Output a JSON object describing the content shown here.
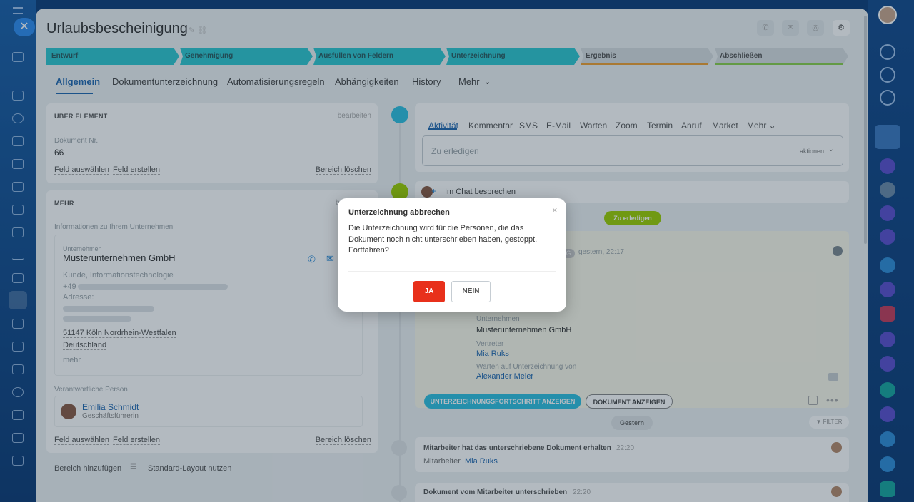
{
  "title": "Urlaubsbescheinigung",
  "stages": [
    {
      "label": "Entwurf",
      "color": "#2fc7d0",
      "text": "#2a5a5f"
    },
    {
      "label": "Genehmigung",
      "color": "#2fc7d0",
      "text": "#2a5a5f"
    },
    {
      "label": "Ausfüllen von Feldern",
      "color": "#2fc7d0",
      "text": "#2a5a5f"
    },
    {
      "label": "Unterzeichnung",
      "color": "#2fc7d0",
      "text": "#2a5a5f"
    },
    {
      "label": "Ergebnis",
      "color": "#d8dde0",
      "text": "#555"
    },
    {
      "label": "Abschließen",
      "color": "#d8dde0",
      "text": "#555"
    }
  ],
  "tabs": [
    "Allgemein",
    "Dokumentunterzeichnung",
    "Automatisierungsregeln",
    "Abhängigkeiten",
    "History",
    "Mehr"
  ],
  "about": {
    "header": "ÜBER ELEMENT",
    "edit": "bearbeiten",
    "doc_label": "Dokument Nr.",
    "doc_value": "66",
    "select_field": "Feld auswählen",
    "create_field": "Feld erstellen",
    "delete_section": "Bereich löschen"
  },
  "more": {
    "header": "MEHR",
    "edit_fragment": "b",
    "company_info": "Informationen zu Ihrem Unternehmen",
    "company_label": "Unternehmen",
    "company_name": "Musterunternehmen GmbH",
    "company_type": "Kunde, Informationstechnologie",
    "phone_prefix": "+49",
    "address_label": "Adresse:",
    "city": "51147 Köln Nordrhein-Westfalen",
    "country": "Deutschland",
    "mehr": "mehr",
    "resp_label": "Verantwortliche Person",
    "resp_name": "Emilia Schmidt",
    "resp_role": "Geschäftsführerin",
    "select_field": "Feld auswählen",
    "create_field": "Feld erstellen",
    "delete_section": "Bereich löschen"
  },
  "footer": {
    "add_section": "Bereich hinzufügen",
    "standard_layout": "Standard-Layout nutzen"
  },
  "activity": {
    "tabs": [
      "Aktivität",
      "Kommentar",
      "SMS",
      "E-Mail",
      "Warten",
      "Zoom",
      "Termin",
      "Anruf",
      "Market",
      "Mehr"
    ],
    "placeholder": "Zu erledigen",
    "actions": "aktionen"
  },
  "chat": "Im Chat besprechen",
  "todo_badge": "Zu erledigen",
  "doc_item": {
    "badge": "G",
    "time": "gestern, 22:17",
    "company_label": "Unternehmen",
    "company": "Musterunternehmen GmbH",
    "rep_label": "Vertreter",
    "rep": "Mia Ruks",
    "wait_label": "Warten auf Unterzeichnung von",
    "wait": "Alexander Meier",
    "btn_progress": "UNTERZEICHNUNGSFORTSCHRITT ANZEIGEN",
    "btn_doc": "DOKUMENT ANZEIGEN"
  },
  "yesterday": "Gestern",
  "filter": "FILTER",
  "log1": {
    "text": "Mitarbeiter hat das unterschriebene Dokument erhalten",
    "time": "22:20",
    "label": "Mitarbeiter",
    "name": "Mia Ruks"
  },
  "log2": {
    "text": "Dokument vom Mitarbeiter unterschrieben",
    "time": "22:20"
  },
  "modal": {
    "title": "Unterzeichnung abbrechen",
    "body": "Die Unterzeichnung wird für die Personen, die das Dokument noch nicht unterschrieben haben, gestoppt. Fortfahren?",
    "yes": "JA",
    "no": "NEIN",
    "close": "×"
  },
  "colors": {
    "accent": "#2067b0",
    "stage_active": "#2fc7d0",
    "yes": "#e8301b",
    "todo_green": "#9dcf00"
  }
}
